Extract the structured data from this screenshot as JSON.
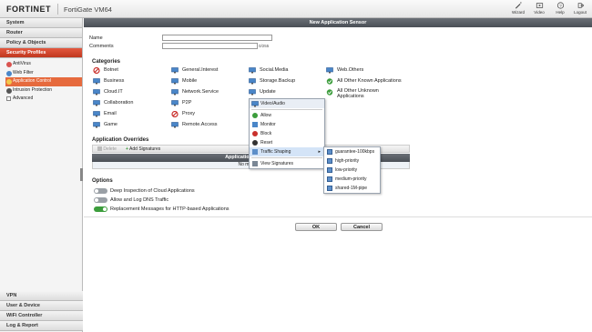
{
  "header": {
    "logo": "FORTINET",
    "product": "FortiGate VM64",
    "buttons": [
      "Wizard",
      "Video",
      "Help",
      "Logout"
    ]
  },
  "nav": {
    "sections_top": [
      "System",
      "Router",
      "Policy & Objects",
      "Security Profiles"
    ],
    "tree": [
      "AntiVirus",
      "Web Filter",
      "Application Control",
      "Intrusion Protection",
      "Advanced"
    ],
    "sections_bottom": [
      "VPN",
      "User & Device",
      "WiFi Controller",
      "Log & Report"
    ]
  },
  "panel": {
    "title": "New Application Sensor",
    "name_label": "Name",
    "comments_label": "Comments",
    "comments_counter": "0/255",
    "categories_title": "Categories",
    "categories": [
      "Botnet",
      "General.Interest",
      "Social.Media",
      "Web.Others",
      "Business",
      "Mobile",
      "Storage.Backup",
      "All Other Known Applications",
      "Cloud.IT",
      "Network.Service",
      "Update",
      "All Other Unknown Applications",
      "Collaboration",
      "P2P",
      "Video/Audio",
      "Email",
      "Proxy",
      "Game",
      "Remote.Access"
    ],
    "overrides_title": "Application Overrides",
    "delete_label": "Delete",
    "add_signatures_label": "Add Signatures",
    "table_header": "Application Signature",
    "table_empty": "No matching",
    "options_title": "Options",
    "options": [
      "Deep Inspection of Cloud Applications",
      "Allow and Log DNS Traffic",
      "Replacement Messages for HTTP-based Applications"
    ],
    "ok_label": "OK",
    "cancel_label": "Cancel"
  },
  "context_menu": {
    "items": [
      "Allow",
      "Monitor",
      "Block",
      "Reset",
      "Traffic Shaping",
      "View Signatures"
    ],
    "submenu": [
      "guarantee-100kbps",
      "high-priority",
      "low-priority",
      "medium-priority",
      "shared-1M-pipe"
    ]
  },
  "colors": {
    "active_nav": "#d04a2f",
    "title_bar": "#5a5f66",
    "toggle_on": "#3c9d3c",
    "menu_highlight": "#d4e4f7"
  }
}
